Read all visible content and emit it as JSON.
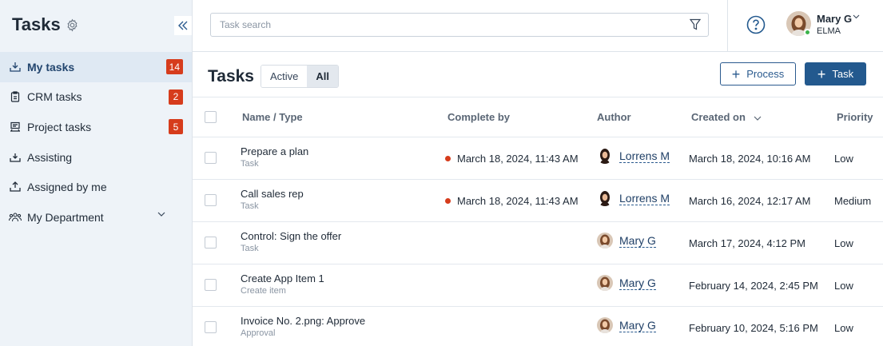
{
  "sidebar": {
    "title": "Tasks",
    "items": [
      {
        "label": "My tasks",
        "badge": "14",
        "icon": "inbox-download-icon"
      },
      {
        "label": "CRM tasks",
        "badge": "2",
        "icon": "clipboard-icon"
      },
      {
        "label": "Project tasks",
        "badge": "5",
        "icon": "project-icon"
      },
      {
        "label": "Assisting",
        "badge": "",
        "icon": "inbox-icon"
      },
      {
        "label": "Assigned by me",
        "badge": "",
        "icon": "upload-icon"
      },
      {
        "label": "My Department",
        "badge": "",
        "icon": "people-icon"
      }
    ]
  },
  "search": {
    "placeholder": "Task search",
    "value": ""
  },
  "user": {
    "name": "Mary G",
    "org": "ELMA"
  },
  "header": {
    "title": "Tasks",
    "filters": [
      "Active",
      "All"
    ],
    "selected_filter": "All",
    "process_label": "Process",
    "task_label": "Task"
  },
  "table": {
    "columns": [
      "Name / Type",
      "Complete by",
      "Author",
      "Created on",
      "Priority"
    ],
    "rows": [
      {
        "name": "Prepare a plan",
        "type": "Task",
        "complete_by": "March 18, 2024, 11:43 AM",
        "author": "Lorrens M",
        "created": "March 18, 2024, 10:16 AM",
        "priority": "Low"
      },
      {
        "name": "Call sales rep",
        "type": "Task",
        "complete_by": "March 18, 2024, 11:43 AM",
        "author": "Lorrens M",
        "created": "March 16, 2024, 12:17 AM",
        "priority": "Medium"
      },
      {
        "name": "Control: Sign the offer",
        "type": "Task",
        "complete_by": "",
        "author": "Mary G",
        "created": "March 17, 2024, 4:12 PM",
        "priority": "Low"
      },
      {
        "name": "Create App Item 1",
        "type": "Create item",
        "complete_by": "",
        "author": "Mary G",
        "created": "February 14, 2024, 2:45 PM",
        "priority": "Low"
      },
      {
        "name": "Invoice No. 2.png: Approve",
        "type": "Approval",
        "complete_by": "",
        "author": "Mary G",
        "created": "February 10, 2024, 5:16 PM",
        "priority": "Low"
      }
    ]
  },
  "colors": {
    "accent": "#23598e",
    "badge": "#d63c1c",
    "overdue": "#d63c1c",
    "sidebar_bg": "#eef3f8"
  }
}
